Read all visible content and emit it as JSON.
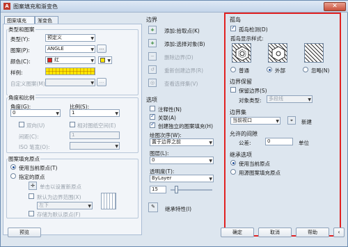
{
  "window": {
    "title": "图案填充和渐变色",
    "title_icon": "A",
    "close_label": "✕"
  },
  "tabs": [
    {
      "label": "图案填充"
    },
    {
      "label": "渐变色"
    }
  ],
  "type_pattern": {
    "heading": "类型和图案",
    "type_label": "类型(Y):",
    "type_value": "预定义",
    "pattern_label": "图案(P):",
    "pattern_value": "ANGLE",
    "color_label": "颜色(C):",
    "color_value": "红",
    "swatch_label": "样例:",
    "custom_label": "自定义图案(M):"
  },
  "angle_scale": {
    "heading": "角度和比例",
    "angle_label": "角度(G):",
    "angle_value": "0",
    "scale_label": "比例(S):",
    "scale_value": "1",
    "double_label": "双向(U)",
    "relative_label": "相对图纸空间(E)",
    "spacing_label": "间距(C):",
    "spacing_value": "1",
    "iso_label": "ISO 笔宽(O):"
  },
  "origin": {
    "heading": "图案填充原点",
    "use_current": "使用当前原点(T)",
    "specified": "指定的原点",
    "click_set": "单击以设置新原点",
    "default_extent": "默认为边界范围(X)",
    "extent_value": "左下",
    "store_default": "存储为默认原点(F)"
  },
  "boundary": {
    "heading": "边界",
    "add_pick": "添加:拾取点(K)",
    "add_select": "添加:选择对象(B)",
    "remove": "删除边界(D)",
    "recreate": "重新创建边界(R)",
    "view": "查看选择集(V)"
  },
  "options": {
    "heading": "选项",
    "annotative": "注释性(N)",
    "associative": "关联(A)",
    "separate": "创建独立的图案填充(H)",
    "draw_order_label": "绘图次序(W):",
    "draw_order_value": "置于边界之前",
    "layer_label": "图层(L):",
    "layer_value": "0",
    "transparency_label": "透明度(T):",
    "transparency_value": "ByLayer",
    "transparency_number": "15"
  },
  "inherit_label": "继承特性(I)",
  "islands": {
    "heading": "孤岛",
    "detection": "孤岛检测(D)",
    "style_label": "孤岛显示样式:",
    "normal": "普通",
    "outer": "外部",
    "ignore": "忽略(N)"
  },
  "boundary_retention": {
    "heading": "边界保留",
    "retain": "保留边界(S)",
    "object_type_label": "对象类型:",
    "object_type_value": "多段线"
  },
  "boundary_set": {
    "heading": "边界集",
    "value": "当前视口",
    "new_label": "新建"
  },
  "gap": {
    "heading": "允许的间隙",
    "tolerance_label": "公差:",
    "tolerance_value": "0",
    "unit_label": "单位"
  },
  "inherit_options": {
    "heading": "继承选项",
    "use_current": "使用当前原点",
    "use_source": "用源图案填充原点"
  },
  "footer": {
    "preview": "预览",
    "ok": "确定",
    "cancel": "取消",
    "help": "帮助"
  },
  "colors": {
    "accent_red": "#e12020",
    "swatch_yellow": "#ffe600"
  }
}
